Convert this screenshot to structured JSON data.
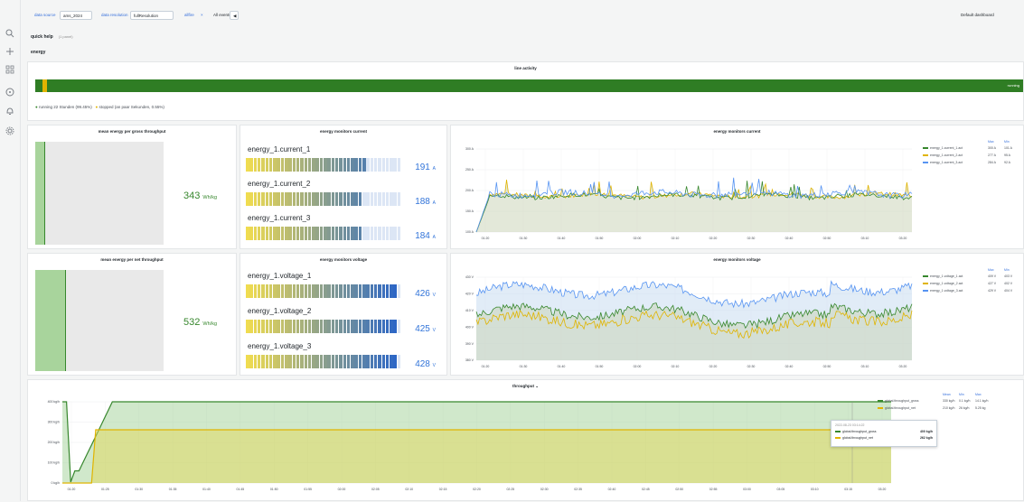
{
  "sidebar": {
    "icons": [
      "search-icon",
      "plus-icon",
      "grid-icon",
      "compass-icon",
      "bell-icon",
      "gear-icon"
    ]
  },
  "topbar": {
    "datasource_label": "data source",
    "datasource_value": "ams_2024",
    "resolution_label": "data resolution",
    "resolution_value": "fullResolution",
    "mode_value": "allfire",
    "events_label": "All events",
    "right_label": "Default dashboard"
  },
  "rows": {
    "quick_help": "quick help",
    "quick_help_sub": "(1 panel)",
    "energy": "energy"
  },
  "line_activity": {
    "title": "line activity",
    "running_value": "running",
    "legend_running": "running 22 Stunden (99.45%)",
    "legend_stopped": "stopped (an paar Sekunden, 0.55%)"
  },
  "stat_gross": {
    "title": "mean energy per gross throughput",
    "value": "343",
    "unit": "Wh/kg",
    "fill_fraction": 0.07
  },
  "stat_net": {
    "title": "mean energy per net throughput",
    "value": "532",
    "unit": "Wh/kg",
    "fill_fraction": 0.23
  },
  "gauges_current": {
    "title": "energy monitors current",
    "items": [
      {
        "label": "energy_1.current_1",
        "value": "191",
        "unit": "A"
      },
      {
        "label": "energy_1.current_2",
        "value": "188",
        "unit": "A"
      },
      {
        "label": "energy_1.current_3",
        "value": "184",
        "unit": "A"
      }
    ]
  },
  "gauges_voltage": {
    "title": "energy monitors voltage",
    "items": [
      {
        "label": "energy_1.voltage_1",
        "value": "426",
        "unit": "V"
      },
      {
        "label": "energy_1.voltage_2",
        "value": "425",
        "unit": "V"
      },
      {
        "label": "energy_1.voltage_3",
        "value": "428",
        "unit": "V"
      }
    ]
  },
  "chart_current": {
    "title": "energy monitors current",
    "legend_headers": [
      "Max",
      "Min"
    ],
    "legend": [
      {
        "name": "energy_1.current_1.act",
        "max": "300 A",
        "min": "101 A",
        "color": "#37872d"
      },
      {
        "name": "energy_1.current_2.act",
        "max": "277 A",
        "min": "95 A",
        "color": "#e0b400"
      },
      {
        "name": "energy_1.current_3.act",
        "max": "284 A",
        "min": "92 A",
        "color": "#5794f2"
      }
    ],
    "yticks": [
      "300 A",
      "250 A",
      "200 A",
      "150 A",
      "100 A"
    ],
    "xticks": [
      "01:20",
      "01:30",
      "01:40",
      "01:50",
      "02:00",
      "02:10",
      "02:20",
      "02:30",
      "02:40",
      "02:50",
      "03:10",
      "03:20"
    ]
  },
  "chart_voltage": {
    "title": "energy monitors voltage",
    "legend_headers": [
      "Max",
      "Min"
    ],
    "legend": [
      {
        "name": "energy_1.voltage_1.act",
        "max": "409 V",
        "min": "403 V",
        "color": "#37872d"
      },
      {
        "name": "energy_1.voltage_2.act",
        "max": "427 V",
        "min": "402 V",
        "color": "#e0b400"
      },
      {
        "name": "energy_1.voltage_3.act",
        "max": "429 V",
        "min": "404 V",
        "color": "#5794f2"
      }
    ],
    "yticks": [
      "430 V",
      "420 V",
      "410 V",
      "400 V",
      "390 V",
      "380 V"
    ],
    "xticks": [
      "01:20",
      "01:30",
      "01:40",
      "01:50",
      "02:00",
      "02:10",
      "02:20",
      "02:30",
      "02:40",
      "02:50",
      "03:10",
      "03:20"
    ]
  },
  "chart_throughput": {
    "title": "throughput",
    "legend_headers": [
      "Mean",
      "Min",
      "Max"
    ],
    "legend": [
      {
        "name": "global.throughput_gross",
        "mean": "330 kg/h",
        "min": "0.1 kg/h",
        "max": "14.1 kg/h",
        "color": "#37872d"
      },
      {
        "name": "global.throughput_net",
        "mean": "210 kg/h",
        "min": "26 kg/h",
        "max": "5.25 kg",
        "color": "#e0b400"
      }
    ],
    "tooltip": {
      "time": "2022-08-23 03:14:22",
      "rows": [
        {
          "name": "global.throughput_gross",
          "value": "400 kg/h"
        },
        {
          "name": "global.throughput_net",
          "value": "262 kg/h"
        }
      ]
    },
    "yticks": [
      "400 kg/h",
      "300 kg/h",
      "200 kg/h",
      "100 kg/h",
      "0 kg/h"
    ],
    "xticks": [
      "01:20",
      "01:25",
      "01:30",
      "01:35",
      "01:40",
      "01:45",
      "01:50",
      "01:55",
      "02:00",
      "02:05",
      "02:10",
      "02:15",
      "02:20",
      "02:25",
      "02:30",
      "02:35",
      "02:40",
      "02:45",
      "02:50",
      "02:55",
      "03:00",
      "03:05",
      "03:10",
      "03:15",
      "03:20"
    ]
  },
  "colors": {
    "green": "#37872d",
    "yellow": "#e0b400",
    "blue": "#5794f2",
    "link": "#3871dc"
  }
}
